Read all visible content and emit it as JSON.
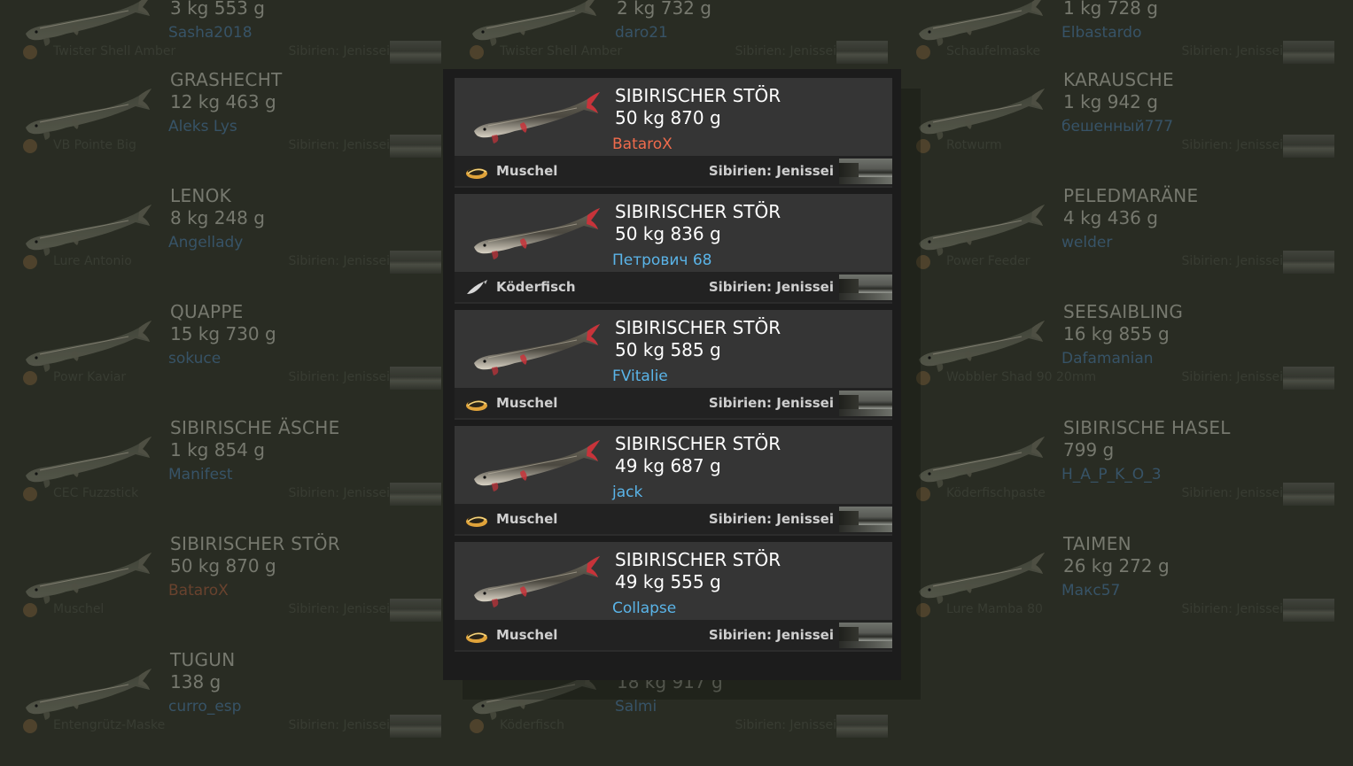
{
  "background": {
    "columns": [
      [
        {
          "name": "",
          "weight": "3 kg 553 g",
          "player": "Sasha2018",
          "player_color": "blue",
          "bait": "Twister Shell Amber",
          "location": "Sibirien: Jenissei"
        },
        {
          "name": "GRASHECHT",
          "weight": "12 kg 463 g",
          "player": "Aleks Lys",
          "player_color": "blue",
          "bait": "VB Pointe Big",
          "location": "Sibirien: Jenissei"
        },
        {
          "name": "LENOK",
          "weight": "8 kg 248 g",
          "player": "Angellady",
          "player_color": "blue",
          "bait": "Lure Antonio",
          "location": "Sibirien: Jenissei"
        },
        {
          "name": "QUAPPE",
          "weight": "15 kg 730 g",
          "player": "sokuce",
          "player_color": "blue",
          "bait": "Powr Kaviar",
          "location": "Sibirien: Jenissei"
        },
        {
          "name": "SIBIRISCHE ÄSCHE",
          "weight": "1 kg 854 g",
          "player": "Manifest",
          "player_color": "blue",
          "bait": "CEC Fuzzstick",
          "location": "Sibirien: Jenissei"
        },
        {
          "name": "SIBIRISCHER STÖR",
          "weight": "50 kg 870 g",
          "player": "BataroX",
          "player_color": "orange",
          "bait": "Muschel",
          "location": "Sibirien: Jenissei"
        },
        {
          "name": "TUGUN",
          "weight": "138 g",
          "player": "curro_esp",
          "player_color": "blue",
          "bait": "Entengrütz-Maske",
          "location": "Sibirien: Jenissei"
        }
      ],
      [
        {
          "name": "",
          "weight": "2 kg 732 g",
          "player": "daro21",
          "player_color": "blue",
          "bait": "Twister Shell Amber",
          "location": "Sibirien: Jenissei"
        },
        {
          "name": "",
          "weight": "18 kg 917 g",
          "player": "Salmi",
          "player_color": "blue",
          "bait": "Köderfisch",
          "location": "Sibirien: Jenissei"
        }
      ],
      [
        {
          "name": "",
          "weight": "1 kg 728 g",
          "player": "Elbastardo",
          "player_color": "blue",
          "bait": "Schaufelmaske",
          "location": "Sibirien: Jenissei"
        },
        {
          "name": "KARAUSCHE",
          "weight": "1 kg 942 g",
          "player": "бешенный777",
          "player_color": "blue",
          "bait": "Rotwurm",
          "location": "Sibirien: Jenissei"
        },
        {
          "name": "PELEDMARÄNE",
          "weight": "4 kg 436 g",
          "player": "welder",
          "player_color": "blue",
          "bait": "Power Feeder",
          "location": "Sibirien: Jenissei"
        },
        {
          "name": "SEESAIBLING",
          "weight": "16 kg 855 g",
          "player": "Dafamanian",
          "player_color": "blue",
          "bait": "Wobbler Shad 90 20mm",
          "location": "Sibirien: Jenissei"
        },
        {
          "name": "SIBIRISCHE HASEL",
          "weight": "799 g",
          "player": "H_A_P_K_O_3",
          "player_color": "blue",
          "bait": "Köderfischpaste",
          "location": "Sibirien: Jenissei"
        },
        {
          "name": "TAIMEN",
          "weight": "26 kg 272 g",
          "player": "Макс57",
          "player_color": "blue",
          "bait": "Lure Mamba 80",
          "location": "Sibirien: Jenissei"
        }
      ]
    ]
  },
  "modal": {
    "entries": [
      {
        "name": "SIBIRISCHER STÖR",
        "weight": "50 kg 870 g",
        "player": "BataroX",
        "player_color": "#ef6b4c",
        "bait": "Muschel",
        "bait_icon": "mussel-icon",
        "location": "Sibirien: Jenissei"
      },
      {
        "name": "SIBIRISCHER STÖR",
        "weight": "50 kg 836 g",
        "player": "Петрович 68",
        "player_color": "#5ab4e8",
        "bait": "Köderfisch",
        "bait_icon": "baitfish-icon",
        "location": "Sibirien: Jenissei"
      },
      {
        "name": "SIBIRISCHER STÖR",
        "weight": "50 kg 585 g",
        "player": "FVitalie",
        "player_color": "#5ab4e8",
        "bait": "Muschel",
        "bait_icon": "mussel-icon",
        "location": "Sibirien: Jenissei"
      },
      {
        "name": "SIBIRISCHER STÖR",
        "weight": "49 kg 687 g",
        "player": "jack",
        "player_color": "#5ab4e8",
        "bait": "Muschel",
        "bait_icon": "mussel-icon",
        "location": "Sibirien: Jenissei"
      },
      {
        "name": "SIBIRISCHER STÖR",
        "weight": "49 kg 555 g",
        "player": "Collapse",
        "player_color": "#5ab4e8",
        "bait": "Muschel",
        "bait_icon": "mussel-icon",
        "location": "Sibirien: Jenissei"
      }
    ]
  },
  "colors": {
    "modal_bg": "#1c1c1c",
    "card_bg": "#353535",
    "card_bar_bg": "#222222",
    "player_top": "#ef6b4c",
    "player_default": "#5ab4e8"
  }
}
